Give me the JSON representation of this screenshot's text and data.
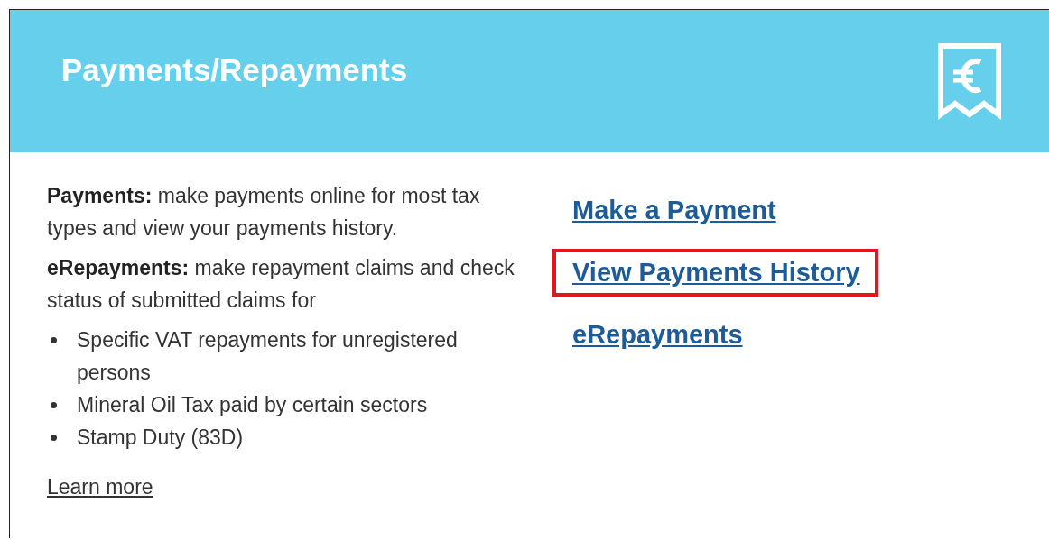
{
  "card": {
    "title": "Payments/Repayments",
    "descriptions": [
      {
        "text": "**Payments:** make payments online for most tax types and view your payments history."
      },
      {
        "text": "**eRepayments:** make repayment claims and check status of submitted claims for",
        "bullets": [
          "Specific VAT repayments for unregistered persons",
          "Mineral Oil Tax paid by certain sectors",
          "Stamp Duty (83D)"
        ]
      }
    ],
    "learn_more": "Learn more",
    "links": [
      {
        "label": "Make a Payment",
        "highlighted": false
      },
      {
        "label": "View Payments History",
        "highlighted": true
      },
      {
        "label": "eRepayments",
        "highlighted": false
      }
    ]
  }
}
